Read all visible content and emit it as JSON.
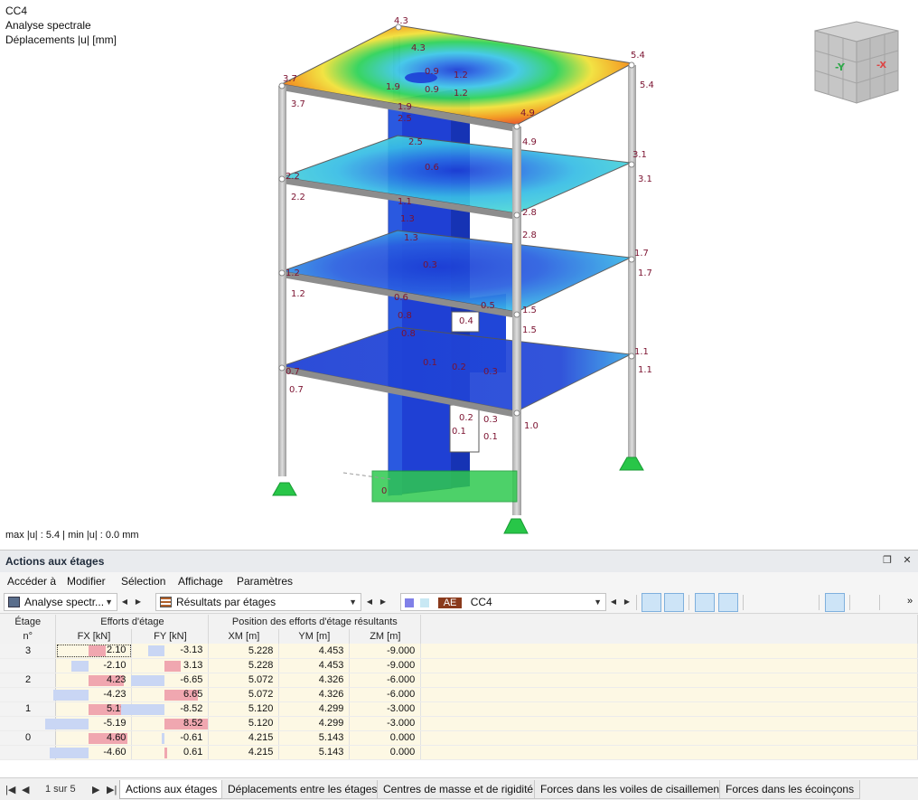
{
  "view": {
    "line1": "CC4",
    "line2": "Analyse spectrale",
    "line3": "Déplacements |u| [mm]",
    "status": "max |u| : 5.4 | min |u| : 0.0 mm",
    "navcube": {
      "left_face": "-Y",
      "right_face": "-X"
    },
    "labels": {
      "corner_top_left": "4.3",
      "corner_top_left_b": "4.3",
      "roof_left": "3.7",
      "roof_left_b": "3.7",
      "roof_right": "5.4",
      "roof_right_b": "5.4",
      "roof_front": "4.9",
      "roof_front_b": "4.9",
      "roof_c1": "0.9",
      "roof_c2": "0.9",
      "roof_c3": "1.2",
      "roof_c4": "1.2",
      "roof_c5": "1.9",
      "roof_c6": "1.9",
      "roof_c7": "2.5",
      "roof_c8": "2.5",
      "f2_left": "2.2",
      "f2_left_b": "2.2",
      "f2_right": "3.1",
      "f2_right_b": "3.1",
      "f2_front": "2.8",
      "f2_front_b": "2.8",
      "f2_c1": "0.6",
      "f2_c2": "1.1",
      "f2_c3": "1.3",
      "f2_c4": "1.3",
      "f1_left": "1.2",
      "f1_left_b": "1.2",
      "f1_right": "1.7",
      "f1_right_b": "1.7",
      "f1_front": "1.5",
      "f1_front_b": "1.5",
      "f1_c1": "0.3",
      "f1_c2": "0.6",
      "f1_c3": "0.8",
      "f1_c4": "0.8",
      "f1_c5": "0.5",
      "f1_c6": "0.4",
      "f0_left": "0.7",
      "f0_left_b": "0.7",
      "f0_right": "1.1",
      "f0_right_b": "1.1",
      "f0_front": "1.0",
      "f0_c1": "0.1",
      "f0_c2": "0.2",
      "f0_c3": "0.3",
      "f0_c4": "0.3",
      "f0_c5": "0.1",
      "f0_c6": "0.2",
      "f0_c7": "0.1",
      "base": "0"
    },
    "colors": {
      "blue": "#1d3fd6",
      "cyan": "#3fc8e8",
      "green": "#2fd35a",
      "yellow": "#f2e23a",
      "orange": "#f39a1b",
      "red": "#e02424",
      "support": "#28c648"
    }
  },
  "panel": {
    "title": "Actions aux étages",
    "menu": [
      "Accéder à",
      "Modifier",
      "Sélection",
      "Affichage",
      "Paramètres"
    ],
    "combo_analysis": "Analyse spectr...",
    "combo_results": "Résultats par étages",
    "load_tag": "AE",
    "load_case": "CC4",
    "table": {
      "header_storey_1": "Étage",
      "header_storey_2": "n°",
      "group_forces": "Efforts d'étage",
      "group_position": "Position des efforts d'étage résultants",
      "col_fx": "FX [kN]",
      "col_fy": "FY [kN]",
      "col_xm": "XM [m]",
      "col_ym": "YM [m]",
      "col_zm": "ZM [m]",
      "rows": [
        {
          "storey": "3",
          "fx": "2.10",
          "fy": "-3.13",
          "fx_ratio": 0.4,
          "fy_ratio": -0.37,
          "xm": "5.228",
          "ym": "4.453",
          "zm": "-9.000"
        },
        {
          "storey": "",
          "fx": "-2.10",
          "fy": "3.13",
          "fx_ratio": -0.4,
          "fy_ratio": 0.37,
          "xm": "5.228",
          "ym": "4.453",
          "zm": "-9.000"
        },
        {
          "storey": "2",
          "fx": "4.23",
          "fy": "-6.65",
          "fx_ratio": 0.81,
          "fy_ratio": -0.78,
          "xm": "5.072",
          "ym": "4.326",
          "zm": "-6.000"
        },
        {
          "storey": "",
          "fx": "-4.23",
          "fy": "6.65",
          "fx_ratio": -0.81,
          "fy_ratio": 0.78,
          "xm": "5.072",
          "ym": "4.326",
          "zm": "-6.000"
        },
        {
          "storey": "1",
          "fx": "5.19",
          "fy": "-8.52",
          "fx_ratio": 1.0,
          "fy_ratio": -1.0,
          "xm": "5.120",
          "ym": "4.299",
          "zm": "-3.000"
        },
        {
          "storey": "",
          "fx": "-5.19",
          "fy": "8.52",
          "fx_ratio": -1.0,
          "fy_ratio": 1.0,
          "xm": "5.120",
          "ym": "4.299",
          "zm": "-3.000"
        },
        {
          "storey": "0",
          "fx": "4.60",
          "fy": "-0.61",
          "fx_ratio": 0.89,
          "fy_ratio": -0.07,
          "xm": "4.215",
          "ym": "5.143",
          "zm": "0.000"
        },
        {
          "storey": "",
          "fx": "-4.60",
          "fy": "0.61",
          "fx_ratio": -0.89,
          "fy_ratio": 0.07,
          "xm": "4.215",
          "ym": "5.143",
          "zm": "0.000"
        }
      ]
    },
    "pager": "1 sur 5",
    "tabs": [
      "Actions aux étages",
      "Déplacements entre les étages",
      "Centres de masse et de rigidité",
      "Forces dans les voiles de cisaillement",
      "Forces dans les écoinçons"
    ]
  }
}
